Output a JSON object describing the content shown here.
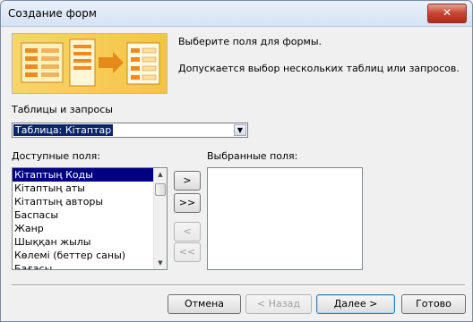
{
  "window": {
    "title": "Создание форм",
    "close_glyph": "✕"
  },
  "intro": {
    "line1": "Выберите поля для формы.",
    "line2": "Допускается выбор нескольких таблиц или запросов."
  },
  "tables_label": "Таблицы и запросы",
  "tables_combo": {
    "value": "Таблица: Кітаптар"
  },
  "available_label": "Доступные поля:",
  "available_fields": [
    "Кітаптың Коды",
    "Кітаптың аты",
    "Кітаптың авторы",
    "Баспасы",
    "Жанр",
    "Шыққан жылы",
    "Көлемі (беттер саны)",
    "Бағасы"
  ],
  "selected_label": "Выбранные поля:",
  "selected_fields": [],
  "transfer_buttons": {
    "add_one": ">",
    "add_all": ">>",
    "remove_one": "<",
    "remove_all": "<<"
  },
  "footer": {
    "cancel": "Отмена",
    "back": "< Назад",
    "next": "Далее >",
    "finish": "Готово"
  }
}
